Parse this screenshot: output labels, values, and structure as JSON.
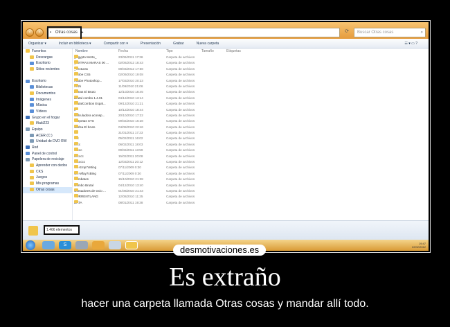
{
  "explorer": {
    "address": [
      "Otras cosas",
      "▸"
    ],
    "search_placeholder": "Buscar Otras cosas",
    "toolbar": [
      "Organizar ▾",
      "Incluir en biblioteca ▾",
      "Compartir con ▾",
      "Presentación",
      "Grabar",
      "Nueva carpeta"
    ],
    "nav_items": [
      {
        "label": "Favoritos",
        "kind": "fav"
      },
      {
        "label": "Descargas",
        "kind": "fold"
      },
      {
        "label": "Escritorio",
        "kind": "lib"
      },
      {
        "label": "Sitios recientes",
        "kind": "fold"
      },
      {
        "label": "",
        "kind": ""
      },
      {
        "label": "Escritorio",
        "kind": "lib"
      },
      {
        "label": "Bibliotecas",
        "kind": "lib"
      },
      {
        "label": "Documentos",
        "kind": "fold"
      },
      {
        "label": "Imágenes",
        "kind": "lib"
      },
      {
        "label": "Música",
        "kind": "lib"
      },
      {
        "label": "Vídeos",
        "kind": "lib"
      },
      {
        "label": "Grupo en el hogar",
        "kind": "net"
      },
      {
        "label": "Iñaki223",
        "kind": "fold"
      },
      {
        "label": "Equipo",
        "kind": "pc"
      },
      {
        "label": "ACER (C:)",
        "kind": "pc"
      },
      {
        "label": "Unidad de DVD RW",
        "kind": "pc"
      },
      {
        "label": "Red",
        "kind": "net"
      },
      {
        "label": "Panel de control",
        "kind": "lib"
      },
      {
        "label": "Papelera de reciclaje",
        "kind": "pc"
      },
      {
        "label": "Aprender con dedos",
        "kind": "fold"
      },
      {
        "label": "CKS",
        "kind": "fold"
      },
      {
        "label": "Juegos",
        "kind": "fold"
      },
      {
        "label": "Mis programas",
        "kind": "fold"
      },
      {
        "label": "Otras cosas",
        "kind": "fold",
        "selected": true
      }
    ],
    "columns": [
      "Nombre",
      "Fecha",
      "Tipo",
      "Tamaño",
      "Etiquetas"
    ],
    "files": [
      {
        "name": "_Egypto Morte_",
        "date": "23/06/2011 17:36",
        "type": "Carpeta de archivos"
      },
      {
        "name": "_EXTRAS MARAS 00 ...",
        "date": "02/06/2012 18:43",
        "type": "Carpeta de archivos"
      },
      {
        "name": "_Texturas",
        "date": "08/03/2012 17:58",
        "type": "Carpeta de archivos"
      },
      {
        "name": "Adobe CS5",
        "date": "02/09/2010 19:08",
        "type": "Carpeta de archivos"
      },
      {
        "name": "Adobe Photoshop...",
        "date": "17/03/2010 20:23",
        "type": "Carpeta de archivos"
      },
      {
        "name": "Anzk",
        "date": "11/09/2010 21:06",
        "type": "Carpeta de archivos"
      },
      {
        "name": "Armas El Bruto",
        "date": "12/10/2010 18:45",
        "type": "Carpeta de archivos"
      },
      {
        "name": "Brutal combo 1.4.01",
        "date": "04/12/2010 13:14",
        "type": "Carpeta de archivos"
      },
      {
        "name": "BrutalCombos Espal...",
        "date": "09/12/2010 21:21",
        "type": "Carpeta de archivos"
      },
      {
        "name": "c",
        "date": "10/12/2010 18:44",
        "type": "Carpeta de archivos"
      },
      {
        "name": "Calculadora aconsp...",
        "date": "20/10/2010 17:22",
        "type": "Carpeta de archivos"
      },
      {
        "name": "Carpetas STS",
        "date": "09/02/2010 16:28",
        "type": "Carpeta de archivos"
      },
      {
        "name": "Carlsa El bruto",
        "date": "04/08/2010 22:46",
        "type": "Carpeta de archivos"
      },
      {
        "name": "cc",
        "date": "31/01/2011 17:23",
        "type": "Carpeta de archivos"
      },
      {
        "name": "ccc",
        "date": "05/02/2011 16:02",
        "type": "Carpeta de archivos"
      },
      {
        "name": "cccc",
        "date": "06/02/2011 18:03",
        "type": "Carpeta de archivos"
      },
      {
        "name": "ccccc",
        "date": "09/02/2011 13:59",
        "type": "Carpeta de archivos"
      },
      {
        "name": "cccccc",
        "date": "15/02/2011 20:08",
        "type": "Carpeta de archivos"
      },
      {
        "name": "ccccccc",
        "date": "12/03/2011 20:12",
        "type": "Carpeta de archivos"
      },
      {
        "name": "CK-Emp7xMing",
        "date": "07/11/2009 0:30",
        "type": "Carpeta de archivos"
      },
      {
        "name": "CK-Mfay7xBing",
        "date": "07/11/2009 0:30",
        "type": "Carpeta de archivos"
      },
      {
        "name": "Combates",
        "date": "15/10/2010 21:38",
        "type": "Carpeta de archivos"
      },
      {
        "name": "Combo Brutal",
        "date": "04/12/2010 13:40",
        "type": "Carpeta de archivos"
      },
      {
        "name": "Contadores de Ocio ...",
        "date": "01/08/2010 21:43",
        "type": "Carpeta de archivos"
      },
      {
        "name": "CURRENTLANG",
        "date": "12/08/2010 11:25",
        "type": "Carpeta de archivos"
      },
      {
        "name": "DATA",
        "date": "08/01/2011 19:38",
        "type": "Carpeta de archivos"
      }
    ],
    "item_count": "1.466 elementos"
  },
  "taskbar": {
    "tray_time": "19:47",
    "tray_date": "22/02/2012"
  },
  "caption": {
    "logo": "desmotivaciones.es",
    "title": "Es extraño",
    "subtitle": "hacer una carpeta llamada Otras cosas y mandar allí todo."
  }
}
